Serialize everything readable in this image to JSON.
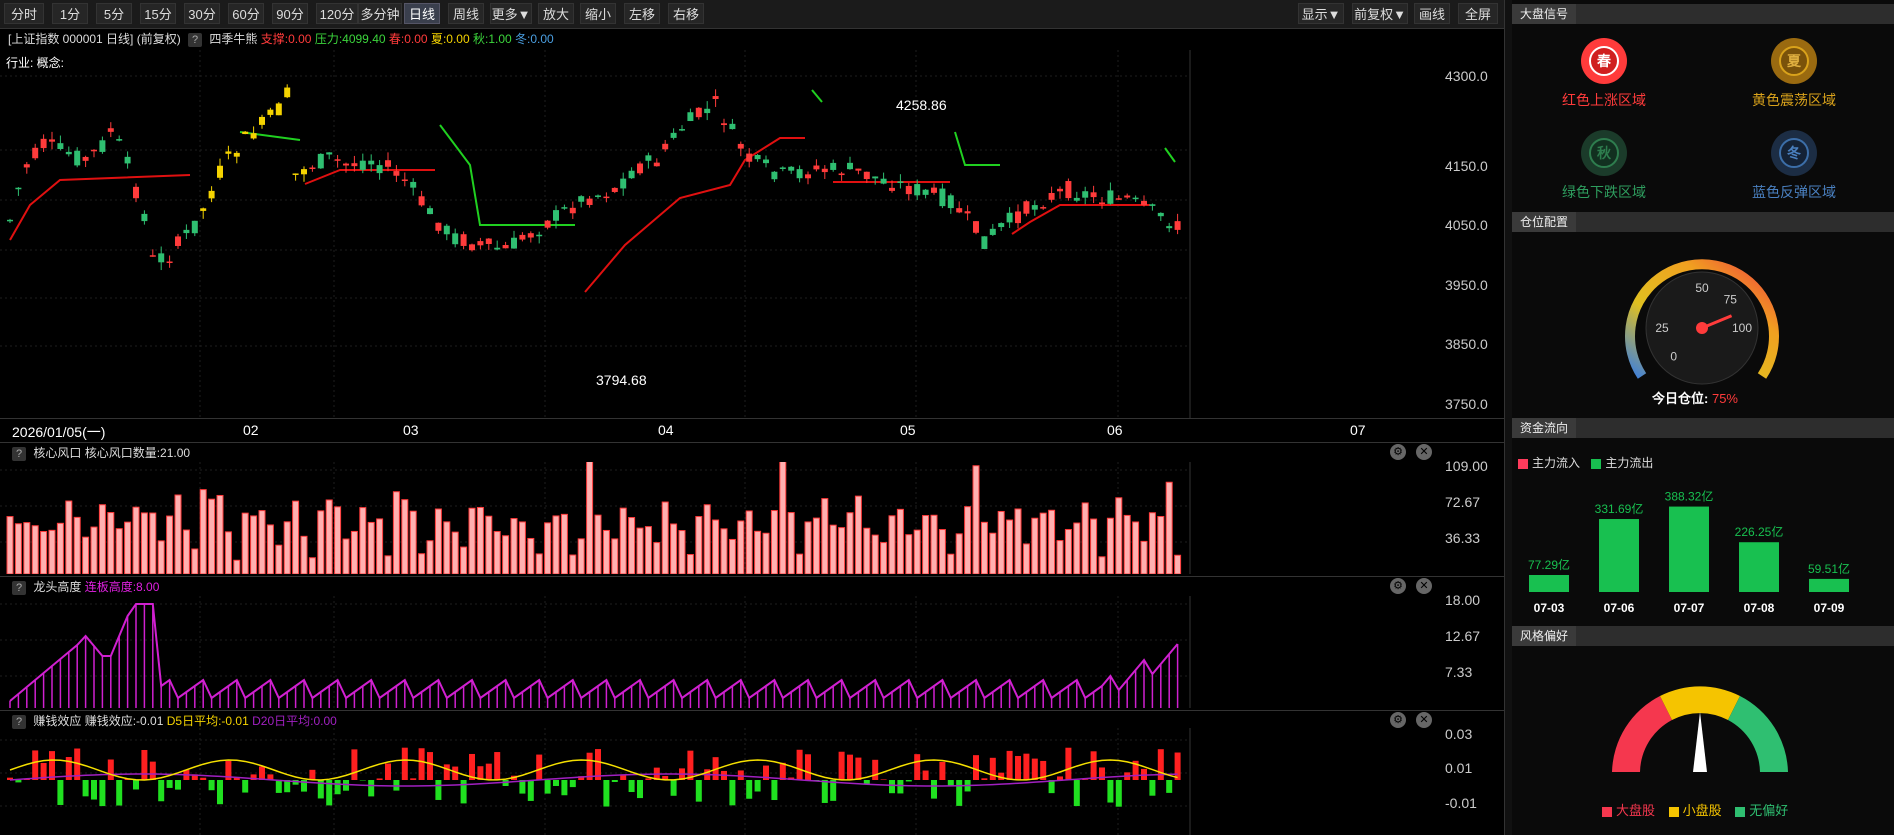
{
  "toolbar": {
    "buttons": [
      "分时",
      "1分",
      "5分",
      "15分",
      "30分",
      "60分",
      "90分",
      "120分",
      "多分钟",
      "日线",
      "周线",
      "更多▼",
      "放大",
      "缩小",
      "左移",
      "右移"
    ],
    "active": "日线",
    "right_buttons": [
      "显示▼",
      "前复权▼",
      "画线",
      "全屏"
    ]
  },
  "info": {
    "symbol": "[上证指数 000001 日线]",
    "adjust": "(前复权)",
    "indicator": "四季牛熊",
    "support": "支撑:0.00",
    "pressure": "压力:4099.40",
    "spring": "春:0.00",
    "summer": "夏:0.00",
    "autumn": "秋:1.00",
    "winter": "冬:0.00",
    "industry": "行业: 概念:"
  },
  "main_chart": {
    "y_ticks": [
      "4300.0",
      "4150.0",
      "4050.0",
      "3950.0",
      "3850.0",
      "3750.0"
    ],
    "x_labels": [
      "2026/01/05(一)",
      "02",
      "03",
      "04",
      "05",
      "06",
      "07"
    ],
    "high_label": "4258.86",
    "low_label": "3794.68"
  },
  "pane1": {
    "title": "核心风口",
    "value": "核心风口数量:21.00",
    "y_ticks": [
      "109.00",
      "72.67",
      "36.33"
    ]
  },
  "pane2": {
    "title": "龙头高度",
    "value": "连板高度:8.00",
    "y_ticks": [
      "18.00",
      "12.67",
      "7.33"
    ]
  },
  "pane3": {
    "title": "赚钱效应",
    "value": "赚钱效应:-0.01",
    "d5": "D5日平均:-0.01",
    "d20": "D20日平均:0.00",
    "y_ticks": [
      "0.03",
      "0.01",
      "-0.01"
    ]
  },
  "right_panel": {
    "market_signal": {
      "title": "大盘信号",
      "items": [
        {
          "glyph": "春",
          "label": "红色上涨区域",
          "color": "#ff3b3b"
        },
        {
          "glyph": "夏",
          "label": "黄色震荡区域",
          "color": "#d9a21b"
        },
        {
          "glyph": "秋",
          "label": "绿色下跌区域",
          "color": "#2e7d4e"
        },
        {
          "glyph": "冬",
          "label": "蓝色反弹区域",
          "color": "#3c6ea8"
        }
      ]
    },
    "position": {
      "title": "仓位配置",
      "ticks": [
        "0",
        "25",
        "50",
        "75",
        "100"
      ],
      "label": "今日仓位:",
      "value": "75%",
      "level": 75
    },
    "fund_flow": {
      "title": "资金流向",
      "legend_in": "主力流入",
      "legend_out": "主力流出",
      "dates": [
        "07-03",
        "07-06",
        "07-07",
        "07-08",
        "07-09"
      ],
      "values": [
        "77.29亿",
        "331.69亿",
        "388.32亿",
        "226.25亿",
        "59.51亿"
      ]
    },
    "style": {
      "title": "风格偏好",
      "legend": [
        "大盘股",
        "小盘股",
        "无偏好"
      ]
    }
  }
}
